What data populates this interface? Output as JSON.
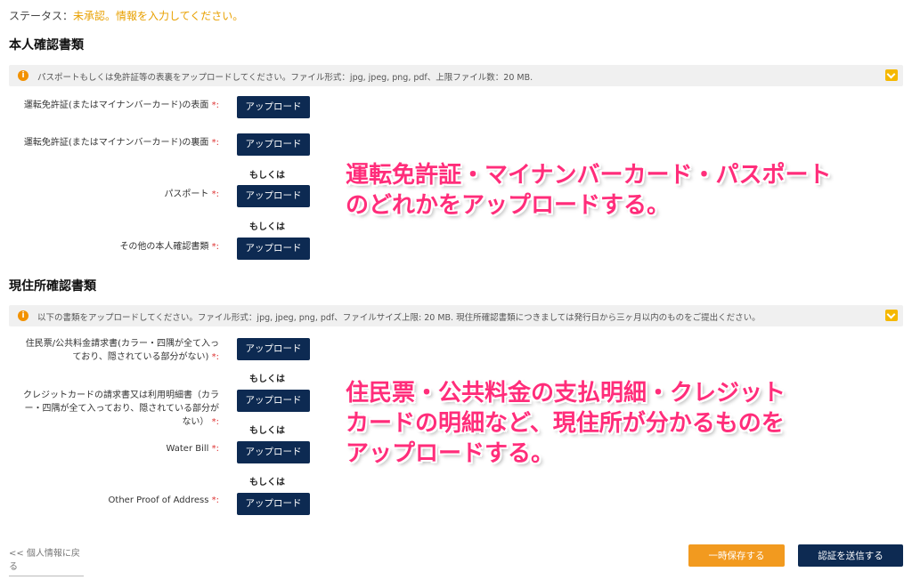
{
  "status": {
    "label": "ステータス：",
    "value": "未承認。情報を入力してください。"
  },
  "identity": {
    "title": "本人確認書類",
    "notice": "パスポートもしくは免許証等の表裏をアップロードしてください。ファイル形式：jpg, jpeg, png, pdf、上限ファイル数：20 MB.",
    "fields": [
      {
        "label": "運転免許証(またはマイナンバーカード)の表面",
        "required": "*:"
      },
      {
        "label": "運転免許証(またはマイナンバーカード)の裏面",
        "required": "*:"
      },
      {
        "label": "パスポート",
        "required": "*:"
      },
      {
        "label": "その他の本人確認書類",
        "required": "*:"
      }
    ]
  },
  "address": {
    "title": "現住所確認書類",
    "notice": "以下の書類をアップロードしてください。ファイル形式：jpg, jpeg, png, pdf、ファイルサイズ上限: 20 MB. 現住所確認書類につきましては発行日から三ヶ月以内のものをご提出ください。",
    "fields": [
      {
        "label_line1": "住民票/公共料金請求書(カラー・四隅が全て入っ",
        "label_line2": "ており、隠されている部分がない)",
        "required": "*:"
      },
      {
        "label_line1": "クレジットカードの請求書又は利用明細書（カラ",
        "label_line2": "ー・四隅が全て入っており、隠されている部分が",
        "label_line3": "ない）",
        "required": "*:"
      },
      {
        "label": "Water Bill",
        "required": "*:"
      },
      {
        "label": "Other Proof of Address",
        "required": "*:"
      }
    ]
  },
  "upload_label": "アップロード",
  "or_label": "もしくは",
  "annotations": {
    "identity_line1": "運転免許証・マイナンバーカード・パスポート",
    "identity_line2": "のどれかをアップロードする。",
    "address_line1": "住民票・公共料金の支払明細・クレジット",
    "address_line2": "カードの明細など、現住所が分かるものを",
    "address_line3": "アップロードする。"
  },
  "footer": {
    "back": "<< 個人情報に戻る",
    "save": "一時保存する",
    "submit": "認証を送信する"
  },
  "colors": {
    "navy": "#0d2a52",
    "orange": "#f29a1f",
    "accent_pink": "#ff2d7a",
    "status_yellow": "#e8a000"
  },
  "icons": {
    "info": "info-icon",
    "expand": "chevron-down-icon"
  }
}
